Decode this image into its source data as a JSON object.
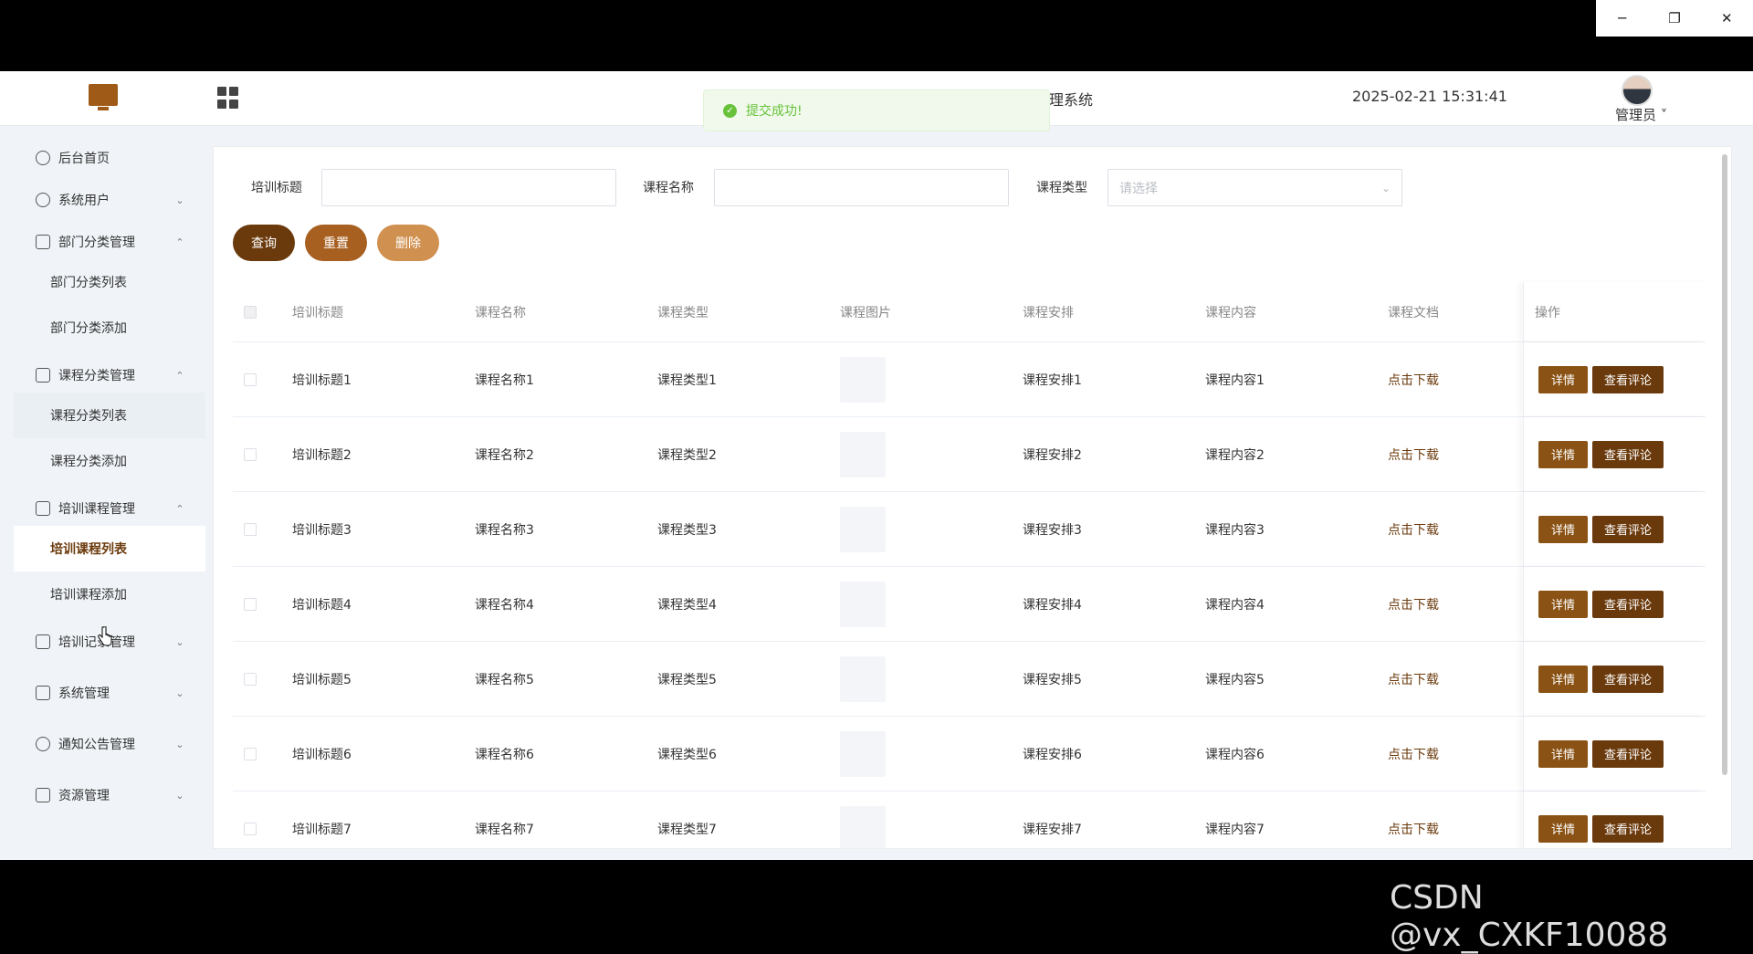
{
  "header": {
    "system_title": "理系统",
    "datetime": "2025-02-21 15:31:41",
    "user_name": "管理员 ˅"
  },
  "toast": {
    "message": "提交成功!"
  },
  "sidebar": {
    "items": [
      {
        "label": "后台首页",
        "type": "group"
      },
      {
        "label": "系统用户",
        "type": "group",
        "expanded": false
      },
      {
        "label": "部门分类管理",
        "type": "group",
        "expanded": true
      },
      {
        "label": "部门分类列表",
        "type": "item"
      },
      {
        "label": "部门分类添加",
        "type": "item"
      },
      {
        "label": "课程分类管理",
        "type": "group",
        "expanded": true
      },
      {
        "label": "课程分类列表",
        "type": "item"
      },
      {
        "label": "课程分类添加",
        "type": "item"
      },
      {
        "label": "培训课程管理",
        "type": "group",
        "expanded": true
      },
      {
        "label": "培训课程列表",
        "type": "item",
        "active": true
      },
      {
        "label": "培训课程添加",
        "type": "item"
      },
      {
        "label": "培训记录管理",
        "type": "group",
        "expanded": false
      },
      {
        "label": "系统管理",
        "type": "group",
        "expanded": false
      },
      {
        "label": "通知公告管理",
        "type": "group",
        "expanded": false
      },
      {
        "label": "资源管理",
        "type": "group",
        "expanded": false
      }
    ]
  },
  "filters": {
    "title_label": "培训标题",
    "title_value": "",
    "course_name_label": "课程名称",
    "course_name_value": "",
    "course_type_label": "课程类型",
    "course_type_placeholder": "请选择"
  },
  "buttons": {
    "query": "查询",
    "reset": "重置",
    "delete": "删除"
  },
  "table": {
    "headers": [
      "培训标题",
      "课程名称",
      "课程类型",
      "课程图片",
      "课程安排",
      "课程内容",
      "课程文档",
      "操作"
    ],
    "rows": [
      {
        "title": "培训标题1",
        "name": "课程名称1",
        "type": "课程类型1",
        "schedule": "课程安排1",
        "content": "课程内容1",
        "doc": "点击下载"
      },
      {
        "title": "培训标题2",
        "name": "课程名称2",
        "type": "课程类型2",
        "schedule": "课程安排2",
        "content": "课程内容2",
        "doc": "点击下载"
      },
      {
        "title": "培训标题3",
        "name": "课程名称3",
        "type": "课程类型3",
        "schedule": "课程安排3",
        "content": "课程内容3",
        "doc": "点击下载"
      },
      {
        "title": "培训标题4",
        "name": "课程名称4",
        "type": "课程类型4",
        "schedule": "课程安排4",
        "content": "课程内容4",
        "doc": "点击下载"
      },
      {
        "title": "培训标题5",
        "name": "课程名称5",
        "type": "课程类型5",
        "schedule": "课程安排5",
        "content": "课程内容5",
        "doc": "点击下载"
      },
      {
        "title": "培训标题6",
        "name": "课程名称6",
        "type": "课程类型6",
        "schedule": "课程安排6",
        "content": "课程内容6",
        "doc": "点击下载"
      },
      {
        "title": "培训标题7",
        "name": "课程名称7",
        "type": "课程类型7",
        "schedule": "课程安排7",
        "content": "课程内容7",
        "doc": "点击下载"
      }
    ],
    "action_detail": "详情",
    "action_comments": "查看评论"
  },
  "watermark": "CSDN @vx_CXKF10088"
}
